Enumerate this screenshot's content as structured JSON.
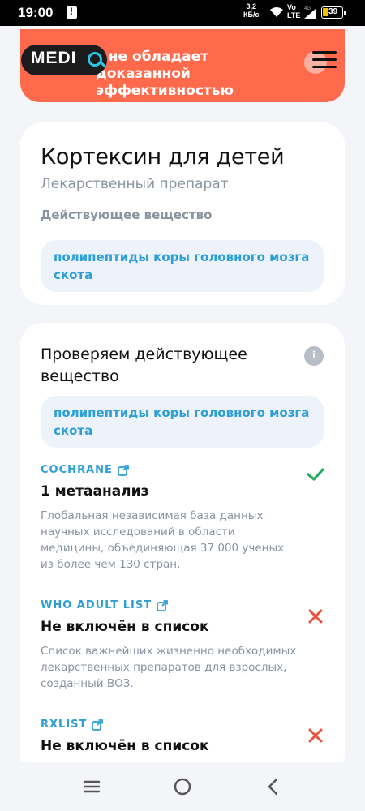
{
  "status_bar": {
    "time": "19:00",
    "speed_value": "3,2",
    "speed_unit": "КБ/с",
    "volte_top": "Vo",
    "volte_bottom": "LTE",
    "network": "4G",
    "battery": "39"
  },
  "header": {
    "logo_text": "MEDI",
    "banner_text": "т не обладает доказанной эффективностью"
  },
  "drug": {
    "title": "Кортексин для детей",
    "type": "Лекарственный препарат",
    "ingredient_label": "Действующее вещество",
    "ingredient": "полипептиды коры головного мозга скота"
  },
  "check": {
    "title": "Проверяем действующее вещество",
    "info_icon": "i",
    "ingredient": "полипептиды коры головного мозга скота",
    "sources": [
      {
        "name": "COCHRANE",
        "result": "1 метаанализ",
        "description": "Глобальная независимая база данных научных исследований в области медицины, объединяющая 37 000 ученых из более чем 130 стран.",
        "status": "check",
        "status_color": "#27ae60"
      },
      {
        "name": "WHO ADULT LIST",
        "result": "Не включён в список",
        "description": "Список важнейших жизненно необходимых лекарственных препаратов для взрослых, созданный ВОЗ.",
        "status": "cross",
        "status_color": "#e8553d"
      },
      {
        "name": "RXLIST",
        "result": "Не включён в список",
        "description": "",
        "status": "cross",
        "status_color": "#e8553d"
      }
    ]
  },
  "colors": {
    "banner": "#ff6a4d",
    "accent": "#2b9fd6",
    "pill_bg": "#eef3fb"
  }
}
